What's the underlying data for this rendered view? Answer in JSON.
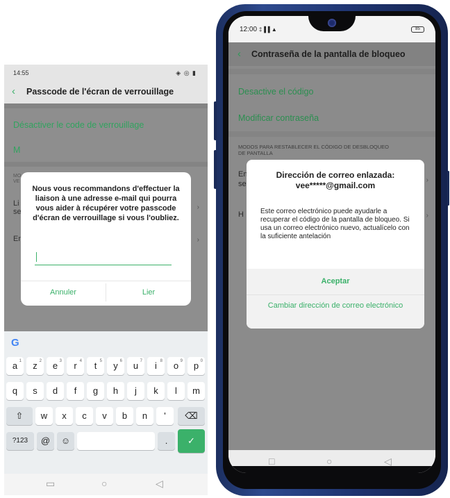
{
  "left": {
    "status": {
      "time": "14:55",
      "icons": "◈ ◎ ▮"
    },
    "header": {
      "back": "‹",
      "title": "Passcode de l'écran de verrouillage"
    },
    "rows": {
      "disable": "Désactiver le code de verrouillage",
      "modify_partial": "M",
      "modes_partial_line1": "MO",
      "modes_partial_line2": "VE",
      "link_partial_line1": "Li",
      "link_partial_line2": "se",
      "en_partial": "En",
      "chevron": "›"
    },
    "dialog": {
      "message": "Nous vous recommandons d'effectuer la liaison à une adresse e-mail qui pourra vous aider à récupérer votre passcode d'écran de verrouillage si vous l'oubliez.",
      "input_value": "",
      "cancel": "Annuler",
      "link": "Lier"
    },
    "keyboard": {
      "google": "G",
      "row1": [
        {
          "k": "a",
          "n": "1"
        },
        {
          "k": "z",
          "n": "2"
        },
        {
          "k": "e",
          "n": "3"
        },
        {
          "k": "r",
          "n": "4"
        },
        {
          "k": "t",
          "n": "5"
        },
        {
          "k": "y",
          "n": "6"
        },
        {
          "k": "u",
          "n": "7"
        },
        {
          "k": "i",
          "n": "8"
        },
        {
          "k": "o",
          "n": "9"
        },
        {
          "k": "p",
          "n": "0"
        }
      ],
      "row2": [
        "q",
        "s",
        "d",
        "f",
        "g",
        "h",
        "j",
        "k",
        "l",
        "m"
      ],
      "row3": [
        "w",
        "x",
        "c",
        "v",
        "b",
        "n",
        "'"
      ],
      "shift": "⇧",
      "backspace": "⌫",
      "symbols": "?123",
      "at": "@",
      "emoji": "☺",
      "period": ".",
      "enter": "✓"
    },
    "nav": {
      "recent": "▭",
      "home": "○",
      "back": "◁"
    }
  },
  "right": {
    "status": {
      "time": "12:00",
      "icons": "‡▐▐ ▲",
      "battery": "85"
    },
    "header": {
      "back": "‹",
      "title": "Contraseña de la pantalla de bloqueo"
    },
    "rows": {
      "disable": "Desactive el código",
      "modify": "Modificar contraseña",
      "modes_line1": "MODOS PARA RESTABLECER EL CÓDIGO DE DESBLOQUEO",
      "modes_line2": "DE PANTALLA",
      "en_partial_line1": "En",
      "en_partial_line2": "se",
      "h_partial": "H",
      "chevron": "›"
    },
    "dialog": {
      "title_line1": "Dirección de correo enlazada:",
      "title_line2": "vee*****@gmail.com",
      "body": "Este correo electrónico puede ayudarle a recuperar el código de la pantalla de bloqueo. Si usa un correo electrónico nuevo, actualícelo con la suficiente antelación",
      "accept": "Aceptar",
      "change": "Cambiar dirección de correo electrónico"
    },
    "nav": {
      "recent": "□",
      "home": "○",
      "back": "◁"
    }
  }
}
